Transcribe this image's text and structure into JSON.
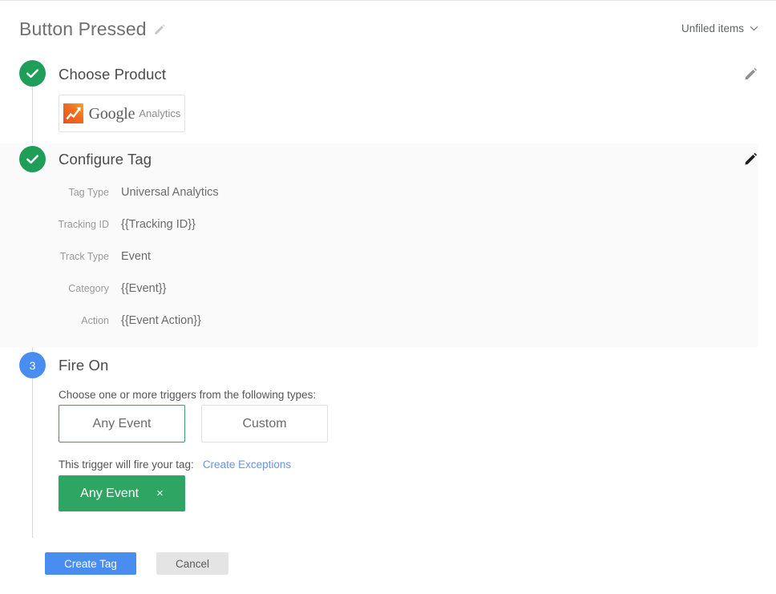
{
  "header": {
    "title": "Button Pressed",
    "title_edit_icon": "pencil-icon",
    "workspace_label": "Unfiled items",
    "workspace_caret_icon": "chevron-down-icon"
  },
  "steps": [
    {
      "id": "choose-product",
      "badge": "check-icon",
      "badge_state": "done",
      "title": "Choose Product",
      "edit_icon": "pencil-icon"
    },
    {
      "id": "configure-tag",
      "badge": "check-icon",
      "badge_state": "done",
      "title": "Configure Tag",
      "edit_icon": "pencil-icon"
    },
    {
      "id": "fire-on",
      "badge": "3",
      "badge_state": "active",
      "title": "Fire On"
    }
  ],
  "product": {
    "logo_icon": "google-analytics-icon",
    "brand": "Google",
    "name": "Analytics"
  },
  "configure_tag": {
    "rows": [
      {
        "label": "Tag Type",
        "value": "Universal Analytics"
      },
      {
        "label": "Tracking ID",
        "value": "{{Tracking ID}}"
      },
      {
        "label": "Track Type",
        "value": "Event"
      },
      {
        "label": "Category",
        "value": "{{Event}}"
      },
      {
        "label": "Action",
        "value": "{{Event Action}}"
      }
    ]
  },
  "fire_on": {
    "hint": "Choose one or more triggers from the following types:",
    "trigger_types": [
      {
        "label": "Any Event",
        "selected": true
      },
      {
        "label": "Custom",
        "selected": false
      }
    ],
    "note": "This trigger will fire your tag:",
    "exceptions_link": "Create Exceptions",
    "selected_trigger": {
      "label": "Any Event",
      "remove_icon": "close-icon",
      "remove_glyph": "×"
    }
  },
  "actions": {
    "primary": "Create Tag",
    "secondary": "Cancel"
  },
  "colors": {
    "done_green": "#1e9e58",
    "active_blue": "#4a8df0",
    "chip_green": "#2fa563",
    "link_blue": "#6a93e8",
    "panel_grey": "#fafafa"
  }
}
